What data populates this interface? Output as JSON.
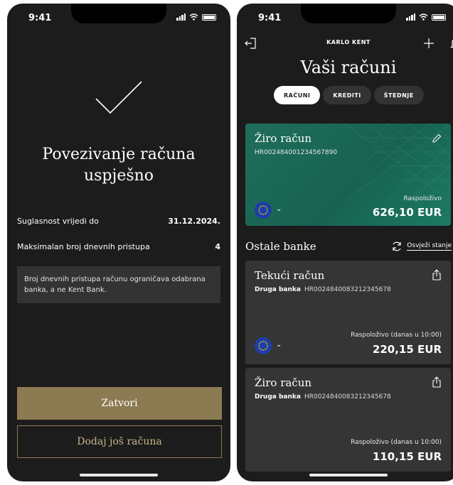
{
  "status_bar": {
    "time": "9:41"
  },
  "left_screen": {
    "title": "Povezivanje računa uspješno",
    "rows": [
      {
        "label": "Suglasnost vrijedi do",
        "value": "31.12.2024."
      },
      {
        "label": "Maksimalan broj dnevnih pristupa",
        "value": "4"
      }
    ],
    "note": "Broj dnevnih pristupa računu ograničava odabrana banka, a ne Kent Bank.",
    "primary_button": "Zatvori",
    "secondary_button": "Dodaj još računa"
  },
  "right_screen": {
    "user_name": "KARLO KENT",
    "title": "Vaši računi",
    "tabs": [
      {
        "label": "RAČUNI",
        "active": true
      },
      {
        "label": "KREDITI",
        "active": false
      },
      {
        "label": "ŠTEDNJE",
        "active": false
      }
    ],
    "main_account": {
      "name": "Žiro račun",
      "iban": "HR002484001234567890",
      "available_label": "Raspoloživo",
      "amount": "626,10 EUR"
    },
    "other_banks_title": "Ostale banke",
    "refresh_label": "Osvježi stanje",
    "other_accounts": [
      {
        "name": "Tekući račun",
        "bank": "Druga banka",
        "iban": "HR0024840083212345678",
        "available_label": "Raspoloživo (danas u 10:00)",
        "amount": "220,15 EUR"
      },
      {
        "name": "Žiro račun",
        "bank": "Druga banka",
        "iban": "HR0024840083212345678",
        "available_label": "Raspoloživo (danas u 10:00)",
        "amount": "110,15 EUR"
      }
    ]
  },
  "colors": {
    "background": "#1c1c1c",
    "gold_accent": "#8c7a52",
    "card_green": "#1f6e5a",
    "card_dark": "#353535"
  }
}
